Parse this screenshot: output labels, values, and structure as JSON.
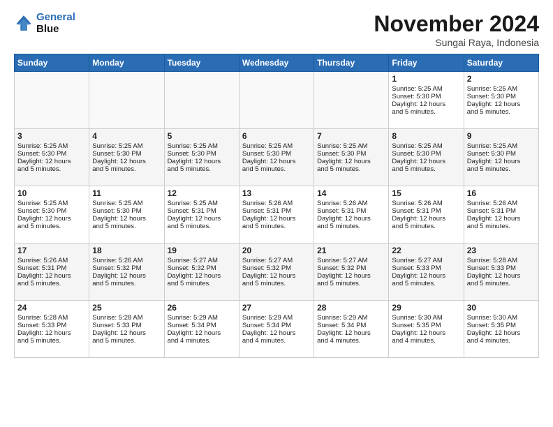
{
  "header": {
    "logo_line1": "General",
    "logo_line2": "Blue",
    "month_title": "November 2024",
    "location": "Sungai Raya, Indonesia"
  },
  "days_of_week": [
    "Sunday",
    "Monday",
    "Tuesday",
    "Wednesday",
    "Thursday",
    "Friday",
    "Saturday"
  ],
  "weeks": [
    [
      {
        "day": "",
        "info": ""
      },
      {
        "day": "",
        "info": ""
      },
      {
        "day": "",
        "info": ""
      },
      {
        "day": "",
        "info": ""
      },
      {
        "day": "",
        "info": ""
      },
      {
        "day": "1",
        "info": "Sunrise: 5:25 AM\nSunset: 5:30 PM\nDaylight: 12 hours\nand 5 minutes."
      },
      {
        "day": "2",
        "info": "Sunrise: 5:25 AM\nSunset: 5:30 PM\nDaylight: 12 hours\nand 5 minutes."
      }
    ],
    [
      {
        "day": "3",
        "info": "Sunrise: 5:25 AM\nSunset: 5:30 PM\nDaylight: 12 hours\nand 5 minutes."
      },
      {
        "day": "4",
        "info": "Sunrise: 5:25 AM\nSunset: 5:30 PM\nDaylight: 12 hours\nand 5 minutes."
      },
      {
        "day": "5",
        "info": "Sunrise: 5:25 AM\nSunset: 5:30 PM\nDaylight: 12 hours\nand 5 minutes."
      },
      {
        "day": "6",
        "info": "Sunrise: 5:25 AM\nSunset: 5:30 PM\nDaylight: 12 hours\nand 5 minutes."
      },
      {
        "day": "7",
        "info": "Sunrise: 5:25 AM\nSunset: 5:30 PM\nDaylight: 12 hours\nand 5 minutes."
      },
      {
        "day": "8",
        "info": "Sunrise: 5:25 AM\nSunset: 5:30 PM\nDaylight: 12 hours\nand 5 minutes."
      },
      {
        "day": "9",
        "info": "Sunrise: 5:25 AM\nSunset: 5:30 PM\nDaylight: 12 hours\nand 5 minutes."
      }
    ],
    [
      {
        "day": "10",
        "info": "Sunrise: 5:25 AM\nSunset: 5:30 PM\nDaylight: 12 hours\nand 5 minutes."
      },
      {
        "day": "11",
        "info": "Sunrise: 5:25 AM\nSunset: 5:30 PM\nDaylight: 12 hours\nand 5 minutes."
      },
      {
        "day": "12",
        "info": "Sunrise: 5:25 AM\nSunset: 5:31 PM\nDaylight: 12 hours\nand 5 minutes."
      },
      {
        "day": "13",
        "info": "Sunrise: 5:26 AM\nSunset: 5:31 PM\nDaylight: 12 hours\nand 5 minutes."
      },
      {
        "day": "14",
        "info": "Sunrise: 5:26 AM\nSunset: 5:31 PM\nDaylight: 12 hours\nand 5 minutes."
      },
      {
        "day": "15",
        "info": "Sunrise: 5:26 AM\nSunset: 5:31 PM\nDaylight: 12 hours\nand 5 minutes."
      },
      {
        "day": "16",
        "info": "Sunrise: 5:26 AM\nSunset: 5:31 PM\nDaylight: 12 hours\nand 5 minutes."
      }
    ],
    [
      {
        "day": "17",
        "info": "Sunrise: 5:26 AM\nSunset: 5:31 PM\nDaylight: 12 hours\nand 5 minutes."
      },
      {
        "day": "18",
        "info": "Sunrise: 5:26 AM\nSunset: 5:32 PM\nDaylight: 12 hours\nand 5 minutes."
      },
      {
        "day": "19",
        "info": "Sunrise: 5:27 AM\nSunset: 5:32 PM\nDaylight: 12 hours\nand 5 minutes."
      },
      {
        "day": "20",
        "info": "Sunrise: 5:27 AM\nSunset: 5:32 PM\nDaylight: 12 hours\nand 5 minutes."
      },
      {
        "day": "21",
        "info": "Sunrise: 5:27 AM\nSunset: 5:32 PM\nDaylight: 12 hours\nand 5 minutes."
      },
      {
        "day": "22",
        "info": "Sunrise: 5:27 AM\nSunset: 5:33 PM\nDaylight: 12 hours\nand 5 minutes."
      },
      {
        "day": "23",
        "info": "Sunrise: 5:28 AM\nSunset: 5:33 PM\nDaylight: 12 hours\nand 5 minutes."
      }
    ],
    [
      {
        "day": "24",
        "info": "Sunrise: 5:28 AM\nSunset: 5:33 PM\nDaylight: 12 hours\nand 5 minutes."
      },
      {
        "day": "25",
        "info": "Sunrise: 5:28 AM\nSunset: 5:33 PM\nDaylight: 12 hours\nand 5 minutes."
      },
      {
        "day": "26",
        "info": "Sunrise: 5:29 AM\nSunset: 5:34 PM\nDaylight: 12 hours\nand 4 minutes."
      },
      {
        "day": "27",
        "info": "Sunrise: 5:29 AM\nSunset: 5:34 PM\nDaylight: 12 hours\nand 4 minutes."
      },
      {
        "day": "28",
        "info": "Sunrise: 5:29 AM\nSunset: 5:34 PM\nDaylight: 12 hours\nand 4 minutes."
      },
      {
        "day": "29",
        "info": "Sunrise: 5:30 AM\nSunset: 5:35 PM\nDaylight: 12 hours\nand 4 minutes."
      },
      {
        "day": "30",
        "info": "Sunrise: 5:30 AM\nSunset: 5:35 PM\nDaylight: 12 hours\nand 4 minutes."
      }
    ]
  ]
}
